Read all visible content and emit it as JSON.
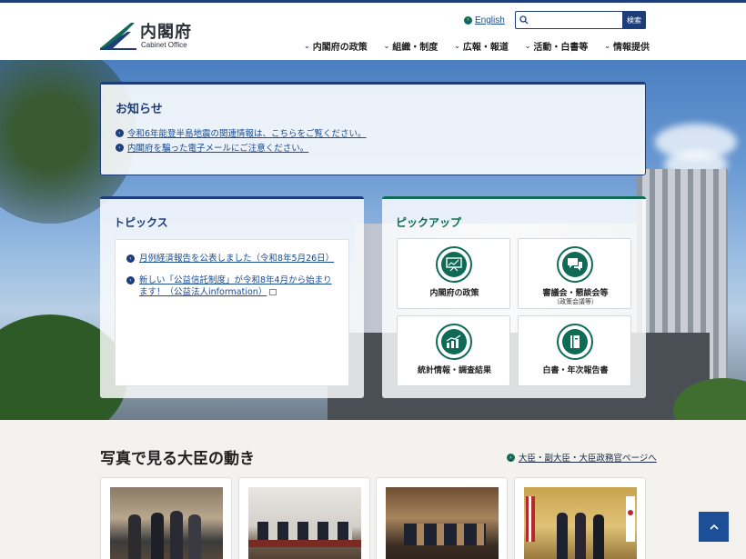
{
  "header": {
    "logo_ja": "内閣府",
    "logo_en": "Cabinet Office",
    "english_link": "English",
    "search": {
      "placeholder": "",
      "button": "検索"
    }
  },
  "nav": {
    "items": [
      {
        "label": "内閣府の政策"
      },
      {
        "label": "組織・制度"
      },
      {
        "label": "広報・報道"
      },
      {
        "label": "活動・白書等"
      },
      {
        "label": "情報提供"
      }
    ]
  },
  "notice": {
    "title": "お知らせ",
    "links": [
      "令和6年能登半島地震の関連情報は、こちらをご覧ください。",
      "内閣府を騙った電子メールにご注意ください。"
    ]
  },
  "topics": {
    "title": "トピックス",
    "items": [
      "月例経済報告を公表しました（令和8年5月26日）",
      "新しい「公益信託制度」が令和8年4月から始まります！（公益法人information）"
    ]
  },
  "pickup": {
    "title": "ピックアップ",
    "cards": [
      {
        "label": "内閣府の政策",
        "sub": "",
        "icon": "presentation-icon"
      },
      {
        "label": "審議会・懇談会等",
        "sub": "（政策会議等）",
        "icon": "chat-icon"
      },
      {
        "label": "統計情報・調査結果",
        "sub": "",
        "icon": "bar-chart-icon"
      },
      {
        "label": "白書・年次報告書",
        "sub": "",
        "icon": "book-icon"
      }
    ]
  },
  "ministers": {
    "title": "写真で見る大臣の動き",
    "link": "大臣・副大臣・大臣政務官ページへ"
  },
  "colors": {
    "primary": "#1d3d7a",
    "accent_green": "#0f6b55",
    "link": "#1a4a8f"
  }
}
